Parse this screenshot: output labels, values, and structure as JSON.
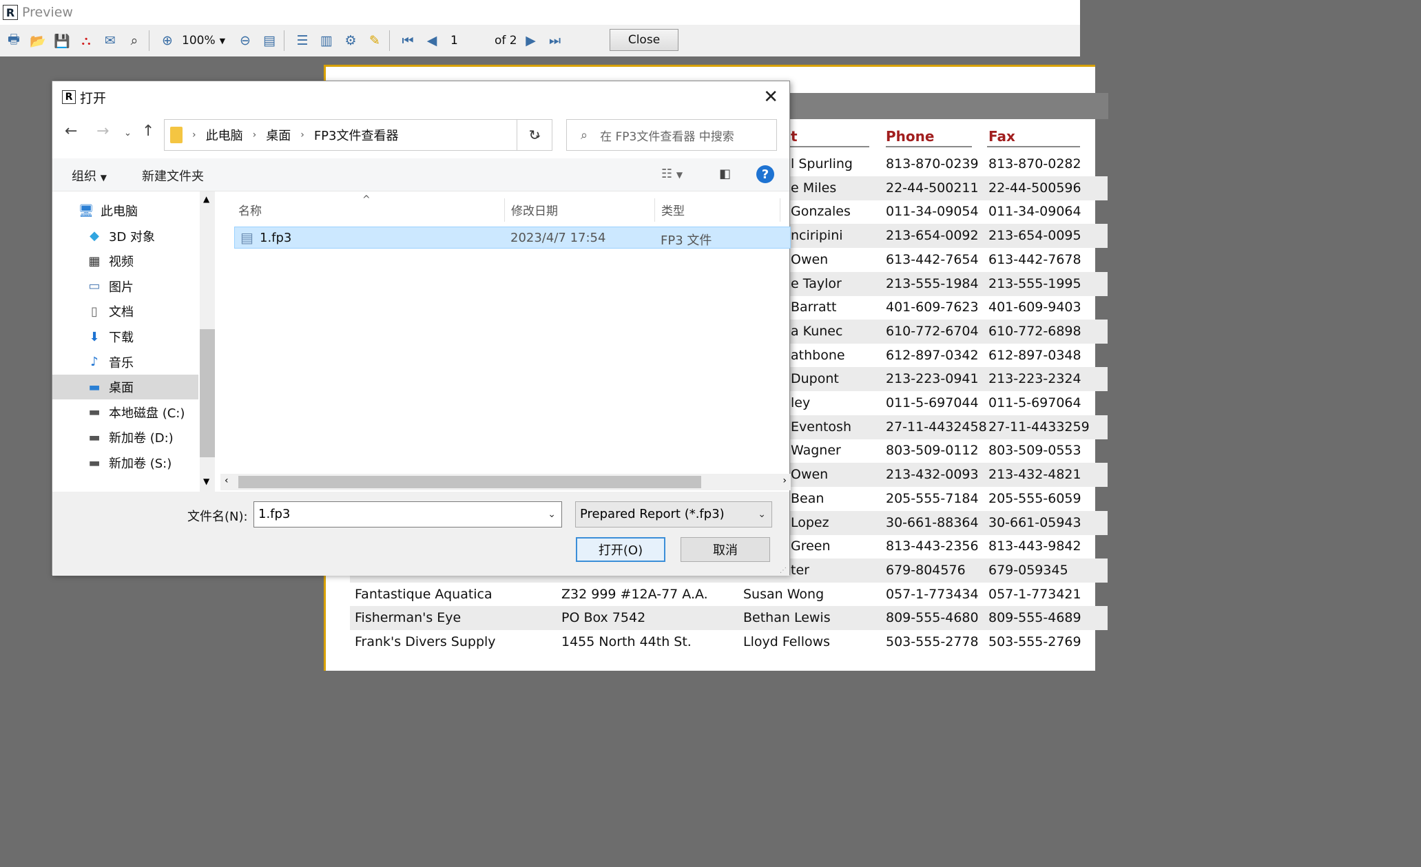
{
  "app": {
    "title": "Preview",
    "logo": "R"
  },
  "toolbar": {
    "zoom": "100%",
    "page": "1",
    "of": "of 2",
    "close": "Close"
  },
  "report": {
    "headers": {
      "contact": "t",
      "phone": "Phone",
      "fax": "Fax"
    },
    "rows": [
      {
        "company": "",
        "address": "",
        "contact": "l Spurling",
        "phone": "813-870-0239",
        "fax": "813-870-0282"
      },
      {
        "company": "",
        "address": "",
        "contact": "e Miles",
        "phone": "22-44-500211",
        "fax": "22-44-500596"
      },
      {
        "company": "",
        "address": "",
        "contact": "Gonzales",
        "phone": "011-34-09054",
        "fax": "011-34-09064"
      },
      {
        "company": "",
        "address": "",
        "contact": "nciripini",
        "phone": "213-654-0092",
        "fax": "213-654-0095"
      },
      {
        "company": "",
        "address": "",
        "contact": "Owen",
        "phone": "613-442-7654",
        "fax": "613-442-7678"
      },
      {
        "company": "",
        "address": "",
        "contact": "e Taylor",
        "phone": "213-555-1984",
        "fax": "213-555-1995"
      },
      {
        "company": "",
        "address": "",
        "contact": "Barratt",
        "phone": "401-609-7623",
        "fax": "401-609-9403"
      },
      {
        "company": "",
        "address": "",
        "contact": "a Kunec",
        "phone": "610-772-6704",
        "fax": "610-772-6898"
      },
      {
        "company": "",
        "address": "",
        "contact": "athbone",
        "phone": "612-897-0342",
        "fax": "612-897-0348"
      },
      {
        "company": "",
        "address": "",
        "contact": "Dupont",
        "phone": "213-223-0941",
        "fax": "213-223-2324"
      },
      {
        "company": "",
        "address": "",
        "contact": "ley",
        "phone": "011-5-697044",
        "fax": "011-5-697064"
      },
      {
        "company": "",
        "address": "",
        "contact": "Eventosh",
        "phone": "27-11-4432458",
        "fax": "27-11-4433259"
      },
      {
        "company": "",
        "address": "",
        "contact": "Wagner",
        "phone": "803-509-0112",
        "fax": "803-509-0553"
      },
      {
        "company": "",
        "address": "",
        "contact": "Owen",
        "phone": "213-432-0093",
        "fax": "213-432-4821"
      },
      {
        "company": "",
        "address": "",
        "contact": "Bean",
        "phone": "205-555-7184",
        "fax": "205-555-6059"
      },
      {
        "company": "",
        "address": "",
        "contact": "Lopez",
        "phone": "30-661-88364",
        "fax": "30-661-05943"
      },
      {
        "company": "",
        "address": "",
        "contact": "Green",
        "phone": "813-443-2356",
        "fax": "813-443-9842"
      },
      {
        "company": "",
        "address": "",
        "contact": "ter",
        "phone": "679-804576",
        "fax": "679-059345"
      },
      {
        "company": "Fantastique Aquatica",
        "address": "Z32 999 #12A-77 A.A.",
        "contact": "Susan Wong",
        "phone": "057-1-773434",
        "fax": "057-1-773421"
      },
      {
        "company": "Fisherman's Eye",
        "address": "PO Box 7542",
        "contact": "Bethan Lewis",
        "phone": "809-555-4680",
        "fax": "809-555-4689"
      },
      {
        "company": "Frank's Divers Supply",
        "address": "1455 North 44th St.",
        "contact": "Lloyd Fellows",
        "phone": "503-555-2778",
        "fax": "503-555-2769"
      }
    ]
  },
  "dialog": {
    "title": "打开",
    "breadcrumb": [
      "此电脑",
      "桌面",
      "FP3文件查看器"
    ],
    "search_placeholder": "在 FP3文件查看器 中搜索",
    "organize": "组织",
    "new_folder": "新建文件夹",
    "tree": [
      {
        "label": "此电脑",
        "icon": "pc-icon"
      },
      {
        "label": "3D 对象",
        "icon": "cube-icon"
      },
      {
        "label": "视频",
        "icon": "video-icon"
      },
      {
        "label": "图片",
        "icon": "picture-icon"
      },
      {
        "label": "文档",
        "icon": "document-icon"
      },
      {
        "label": "下载",
        "icon": "download-icon"
      },
      {
        "label": "音乐",
        "icon": "music-icon"
      },
      {
        "label": "桌面",
        "icon": "desktop-icon"
      },
      {
        "label": "本地磁盘 (C:)",
        "icon": "drive-icon"
      },
      {
        "label": "新加卷 (D:)",
        "icon": "drive-icon"
      },
      {
        "label": "新加卷 (S:)",
        "icon": "drive-icon"
      }
    ],
    "columns": {
      "name": "名称",
      "modified": "修改日期",
      "type": "类型"
    },
    "file": {
      "name": "1.fp3",
      "modified": "2023/4/7 17:54",
      "type": "FP3 文件"
    },
    "filename_label": "文件名(N):",
    "filename_value": "1.fp3",
    "filetype": "Prepared Report (*.fp3)",
    "open_button": "打开(O)",
    "cancel_button": "取消"
  }
}
